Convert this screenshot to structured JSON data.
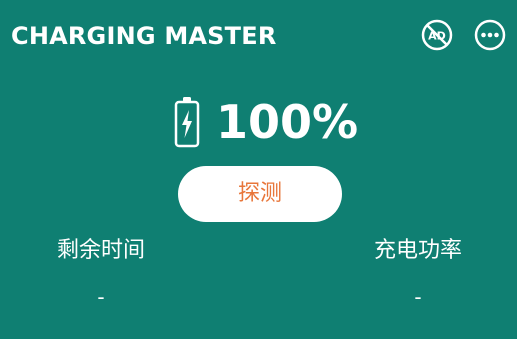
{
  "header": {
    "title": "CHARGING MASTER",
    "ad_icon_text": "AD",
    "ad_icon": "no-ads-icon",
    "more_icon": "more-options-icon"
  },
  "battery": {
    "icon": "charging-battery-icon",
    "percent_text": "100%",
    "level": 1.0
  },
  "detect_button": {
    "label": "探测"
  },
  "stats": [
    {
      "label": "剩余时间",
      "value": "-"
    },
    {
      "label": "充电功率",
      "value": "-"
    }
  ],
  "colors": {
    "background": "#0f7f72",
    "foreground": "#ffffff",
    "button_background": "#ffffff",
    "button_text": "#e8763a"
  }
}
